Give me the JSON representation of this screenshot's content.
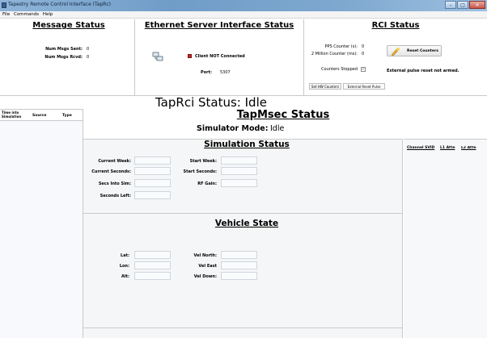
{
  "window": {
    "title": "Tapestry Remote Control Interface (TapRc)",
    "min": "–",
    "max": "□",
    "close": "✕"
  },
  "menu": {
    "file": "File",
    "commands": "Commands",
    "help": "Help"
  },
  "message_status": {
    "title": "Message Status",
    "num_msgs_sent_label": "Num Msgs Sent:",
    "num_msgs_sent": "0",
    "num_msgs_rcvd_label": "Num Msgs Rcvd:",
    "num_msgs_rcvd": "0"
  },
  "ethernet": {
    "title": "Ethernet Server Interface Status",
    "client_status": "Client NOT Connected",
    "port_label": "Port:",
    "port": "5307"
  },
  "rci": {
    "title": "RCI Status",
    "pps_label": "PPS Counter (s):",
    "pps": "0",
    "two_million_label": "2 Million Counter (ms):",
    "two_million": "0",
    "counters_stopped_label": "Counters Stopped",
    "reset_counters": "Reset Counters",
    "external_pulse": "External pulse reset not armed.",
    "tab_set_hw": "Set HW Counters",
    "tab_ext_reset": "External Reset Pulse"
  },
  "taprci_status": "TapRci Status: Idle",
  "log_columns": {
    "time_into_sim": "Time into Simulation",
    "source": "Source",
    "type": "Type"
  },
  "tapmsec": {
    "title": "TapMsec Status",
    "sim_mode_label": "Simulator Mode:",
    "sim_mode": "Idle"
  },
  "simulation": {
    "title": "Simulation Status",
    "current_week": "Current Week:",
    "current_seconds": "Current Seconds:",
    "secs_into_sim": "Secs Into Sim:",
    "seconds_left": "Seconds Left:",
    "start_week": "Start Week:",
    "start_seconds": "Start Seconds:",
    "rf_gain": "RF Gain:"
  },
  "vehicle": {
    "title": "Vehicle State",
    "lat": "Lat:",
    "lon": "Lon:",
    "alt": "Alt:",
    "vel_north": "Vel North:",
    "vel_east": "Vel East",
    "vel_down": "Vel Down:"
  },
  "channel_columns": {
    "channel": "Channel SVID",
    "l1_atten": "L1 Atte",
    "l2_atten": "L2 Atte"
  }
}
